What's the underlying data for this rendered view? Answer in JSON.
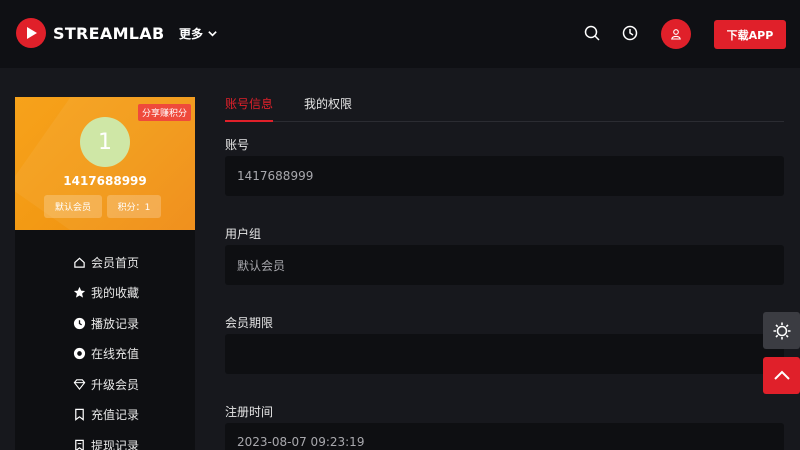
{
  "header": {
    "brand": "STREAMLAB",
    "more_label": "更多",
    "download_label": "下载APP"
  },
  "profile": {
    "share_badge": "分享赚积分",
    "avatar_letter": "1",
    "username": "1417688999",
    "group_label": "默认会员",
    "points_label": "积分：1"
  },
  "sidebar": {
    "items": [
      {
        "label": "会员首页",
        "icon": "home-icon"
      },
      {
        "label": "我的收藏",
        "icon": "star-icon"
      },
      {
        "label": "播放记录",
        "icon": "clock-icon"
      },
      {
        "label": "在线充值",
        "icon": "coin-icon"
      },
      {
        "label": "升级会员",
        "icon": "diamond-icon"
      },
      {
        "label": "充值记录",
        "icon": "bookmark-icon"
      },
      {
        "label": "提现记录",
        "icon": "receipt-icon"
      }
    ]
  },
  "tabs": [
    {
      "label": "账号信息",
      "active": true
    },
    {
      "label": "我的权限",
      "active": false
    }
  ],
  "fields": [
    {
      "label": "账号",
      "value": "1417688999"
    },
    {
      "label": "用户组",
      "value": "默认会员"
    },
    {
      "label": "会员期限",
      "value": ""
    },
    {
      "label": "注册时间",
      "value": "2023-08-07 09:23:19"
    }
  ],
  "colors": {
    "accent": "#e0202a",
    "background": "#17181d",
    "card": "#f39a14"
  }
}
